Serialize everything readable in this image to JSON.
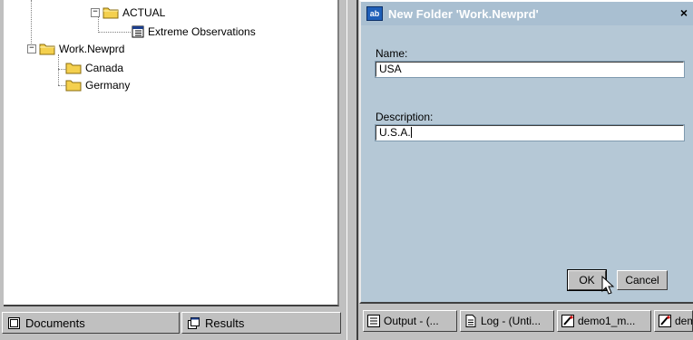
{
  "tree": {
    "nodes": [
      {
        "label": "ACTUAL",
        "kind": "folder",
        "expander": "−"
      },
      {
        "label": "Extreme Observations",
        "kind": "table"
      },
      {
        "label": "Work.Newprd",
        "kind": "folder",
        "expander": "−"
      },
      {
        "label": "Canada",
        "kind": "folder"
      },
      {
        "label": "Germany",
        "kind": "folder"
      }
    ]
  },
  "bottom_tabs": {
    "documents_label": "Documents",
    "results_label": "Results"
  },
  "dialog": {
    "title": "New Folder 'Work.Newprd'",
    "title_icon_text": "ab",
    "close_glyph": "×",
    "name_label": "Name:",
    "name_value": "USA",
    "description_label": "Description:",
    "description_value": "U.S.A.",
    "ok_label": "OK",
    "cancel_label": "Cancel"
  },
  "taskbar": {
    "items": [
      {
        "label": "Output - (...",
        "icon": "output-icon"
      },
      {
        "label": "Log - (Unti...",
        "icon": "log-icon"
      },
      {
        "label": "demo1_m...",
        "icon": "program-icon"
      },
      {
        "label": "dem",
        "icon": "program-icon"
      }
    ]
  },
  "colors": {
    "dialog_bg": "#b5c8d6",
    "titlebar_bg": "#a9bfd1",
    "folder": "#f4d04e",
    "chrome": "#c0c0c0"
  }
}
